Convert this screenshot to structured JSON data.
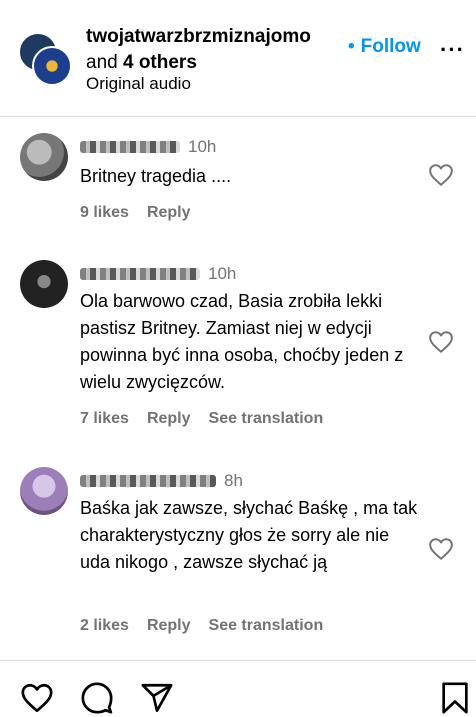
{
  "header": {
    "username": "twojatwarzbrzmiznajomo",
    "and_text": "and",
    "others": "4 others",
    "audio": "Original audio",
    "follow_dot": "•",
    "follow_label": "Follow",
    "more": "···"
  },
  "comments": [
    {
      "time": "10h",
      "text": "Britney tragedia ....",
      "likes": "9 likes",
      "reply": "Reply",
      "translation": ""
    },
    {
      "time": "10h",
      "text": "Ola barwowo czad, Basia zrobiła lekki pastisz Britney. Zamiast niej w edycji powinna być inna osoba, choćby jeden z wielu zwycięzców.",
      "likes": "7 likes",
      "reply": "Reply",
      "translation": "See translation"
    },
    {
      "time": "8h",
      "text": "Baśka jak zawsze, słychać Baśkę , ma tak charakterystyczny głos że sorry ale nie uda nikogo , zawsze słychać ją",
      "likes": "2 likes",
      "reply": "Reply",
      "translation": "See translation"
    }
  ],
  "colors": {
    "follow": "#0095f6",
    "meta": "#737373"
  },
  "icons": [
    "heart-icon",
    "comment-icon",
    "share-icon",
    "bookmark-icon",
    "more-icon"
  ]
}
